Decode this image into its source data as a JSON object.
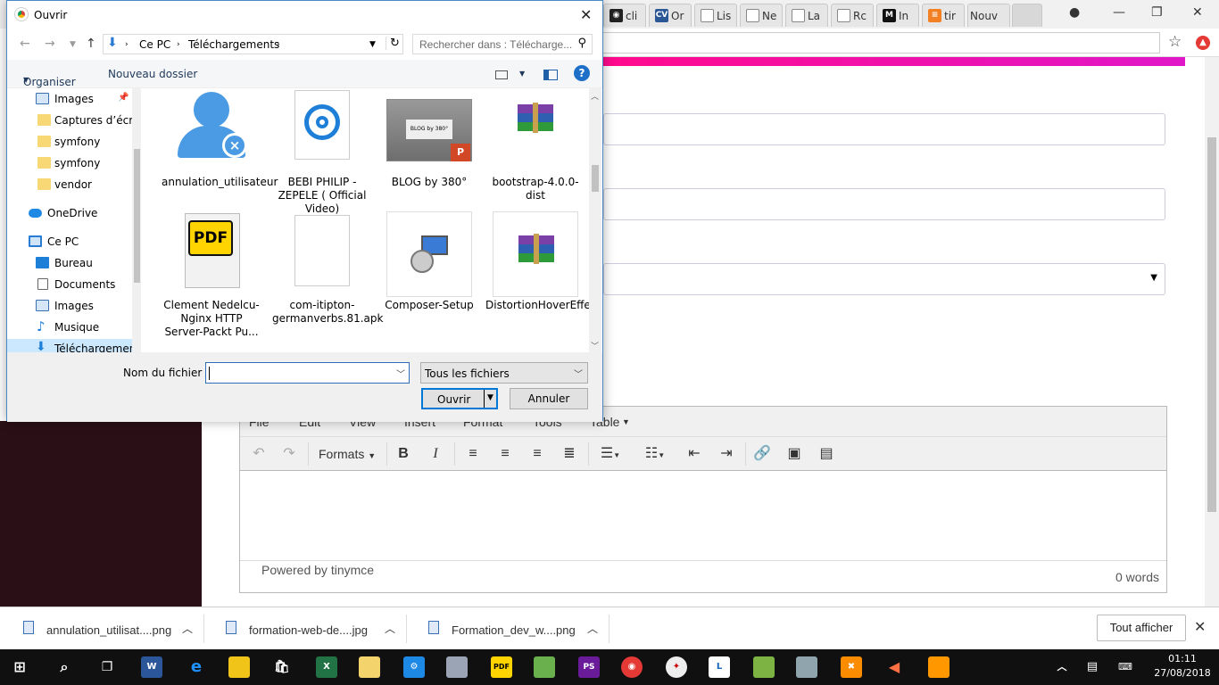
{
  "browser": {
    "tabs": [
      {
        "label": "cli",
        "fav": "github-icon",
        "color": "#222222"
      },
      {
        "label": "Or",
        "fav": "CV",
        "color": "#2b5797"
      },
      {
        "label": "Lis",
        "fav": "doc",
        "color": "#888888"
      },
      {
        "label": "Ne",
        "fav": "doc",
        "color": "#888888"
      },
      {
        "label": "La",
        "fav": "doc",
        "color": "#888888"
      },
      {
        "label": "Rc",
        "fav": "doc",
        "color": "#888888"
      },
      {
        "label": "In",
        "fav": "M",
        "color": "#111111"
      },
      {
        "label": "tir",
        "fav": "stack",
        "color": "#f48024"
      },
      {
        "label": "Nouv",
        "fav": "",
        "color": "#ffffff"
      }
    ]
  },
  "editor": {
    "menu": [
      "File",
      "Edit",
      "View",
      "Insert",
      "Format",
      "Tools",
      "Table"
    ],
    "formats_label": "Formats",
    "powered_by": "Powered by tinymce",
    "word_count": "0 words"
  },
  "downloads": {
    "items": [
      "annulation_utilisat....png",
      "formation-web-de....jpg",
      "Formation_dev_w....png"
    ],
    "show_all": "Tout afficher"
  },
  "clock": {
    "time": "01:11",
    "date": "27/08/2018"
  },
  "dialog": {
    "title": "Ouvrir",
    "breadcrumb": [
      "Ce PC",
      "Téléchargements"
    ],
    "search_placeholder": "Rechercher dans : Télécharge...",
    "organize": "Organiser",
    "new_folder": "Nouveau dossier",
    "nav": [
      {
        "label": "Images",
        "icon": "images-icon"
      },
      {
        "label": "Captures d’écran",
        "icon": "folder-icon"
      },
      {
        "label": "symfony",
        "icon": "folder-icon"
      },
      {
        "label": "symfony",
        "icon": "folder-icon"
      },
      {
        "label": "vendor",
        "icon": "folder-icon"
      },
      {
        "label": "OneDrive",
        "icon": "onedrive-icon"
      },
      {
        "label": "Ce PC",
        "icon": "computer-icon"
      },
      {
        "label": "Bureau",
        "icon": "desktop-icon"
      },
      {
        "label": "Documents",
        "icon": "documents-icon"
      },
      {
        "label": "Images",
        "icon": "images-icon"
      },
      {
        "label": "Musique",
        "icon": "music-icon"
      },
      {
        "label": "Téléchargements",
        "icon": "downloads-icon"
      }
    ],
    "files": [
      {
        "label": "annulation_utilisateur",
        "icon": "user-remove-icon"
      },
      {
        "label": "BEBI PHILIP - ZEPELE ( Official Video)",
        "icon": "groove-music-icon"
      },
      {
        "label": "BLOG by 380°",
        "icon": "powerpoint-icon"
      },
      {
        "label": "bootstrap-4.0.0-dist",
        "icon": "winrar-icon"
      },
      {
        "label": "Clement Nedelcu-Nginx HTTP Server-Packt Pu...",
        "icon": "pdf-icon"
      },
      {
        "label": "com-itipton-germanverbs.81.apk",
        "icon": "blank-file-icon"
      },
      {
        "label": "Composer-Setup",
        "icon": "installer-icon"
      },
      {
        "label": "DistortionHoverEffect",
        "icon": "winrar-icon"
      }
    ],
    "blog_thumb_text": "BLOG by 380°",
    "filename_label": "Nom du fichier :",
    "filename_value": "",
    "filetype": "Tous les fichiers",
    "open": "Ouvrir",
    "cancel": "Annuler"
  },
  "colors": {
    "accent": "#0078d7",
    "pink": "#ff0a8c",
    "dark_page": "#2a0f16"
  }
}
